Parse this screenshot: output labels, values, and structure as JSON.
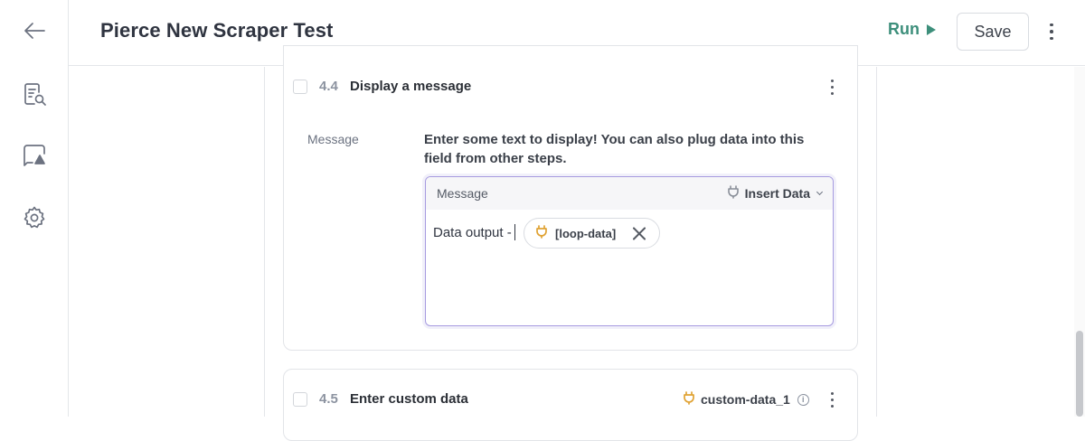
{
  "rail": {
    "icons": [
      "back-arrow-icon",
      "document-search-icon",
      "alert-chat-icon",
      "gear-icon"
    ]
  },
  "header": {
    "title": "Pierce New Scraper Test",
    "run_label": "Run",
    "save_label": "Save"
  },
  "steps": [
    {
      "number": "4.4",
      "title": "Display a message",
      "field": {
        "label": "Message",
        "description": "Enter some text to display! You can also plug data into this field from other steps.",
        "box_label": "Message",
        "insert_label": "Insert Data",
        "value_text": "Data output -",
        "chip_label": "[loop-data]"
      }
    },
    {
      "number": "4.5",
      "title": "Enter custom data",
      "variable": "custom-data_1"
    }
  ],
  "colors": {
    "accent_green": "#3d8f7b",
    "box_border": "#a79be0",
    "plug_orange": "#e0a233"
  }
}
